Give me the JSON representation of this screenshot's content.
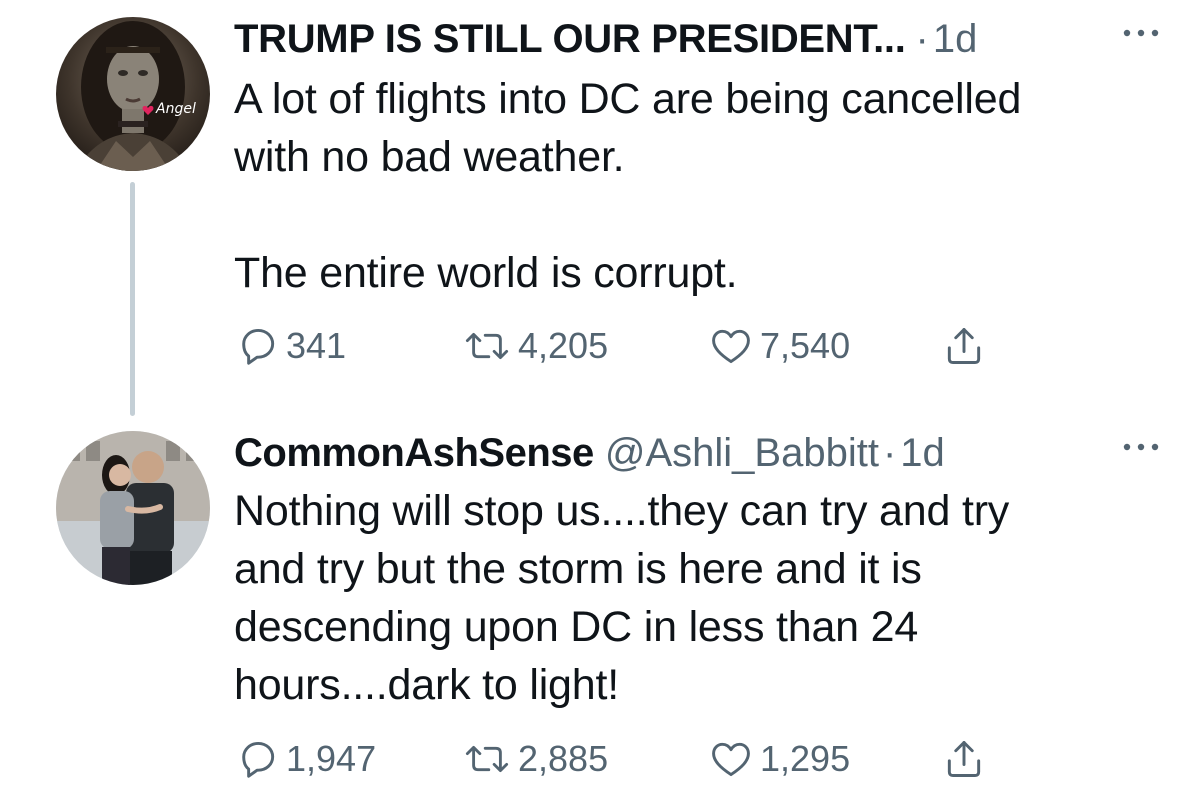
{
  "tweets": [
    {
      "display_name": "TRUMP IS STILL OUR PRESIDENT...",
      "handle": "",
      "separator": "·",
      "timestamp": "1d",
      "text": "A lot of flights into DC are being cancelled\nwith no bad weather.\n\nThe entire world is corrupt.",
      "avatar_badge": "Angel",
      "reply_count": "341",
      "retweet_count": "4,205",
      "like_count": "7,540"
    },
    {
      "display_name": "CommonAshSense",
      "handle": "@Ashli_Babbitt",
      "separator": "·",
      "timestamp": "1d",
      "text": "Nothing will stop us....they can try and try\nand try but the storm is here and it is\ndescending upon DC in less than 24\nhours....dark to light!",
      "reply_count": "1,947",
      "retweet_count": "2,885",
      "like_count": "1,295"
    }
  ],
  "colors": {
    "text_primary": "#0f1419",
    "text_secondary": "#536471",
    "thread_line": "#c4cfd6",
    "background": "#ffffff"
  },
  "icons": {
    "reply": "reply-icon",
    "retweet": "retweet-icon",
    "like": "heart-icon",
    "share": "share-icon",
    "more": "more-options-icon"
  }
}
